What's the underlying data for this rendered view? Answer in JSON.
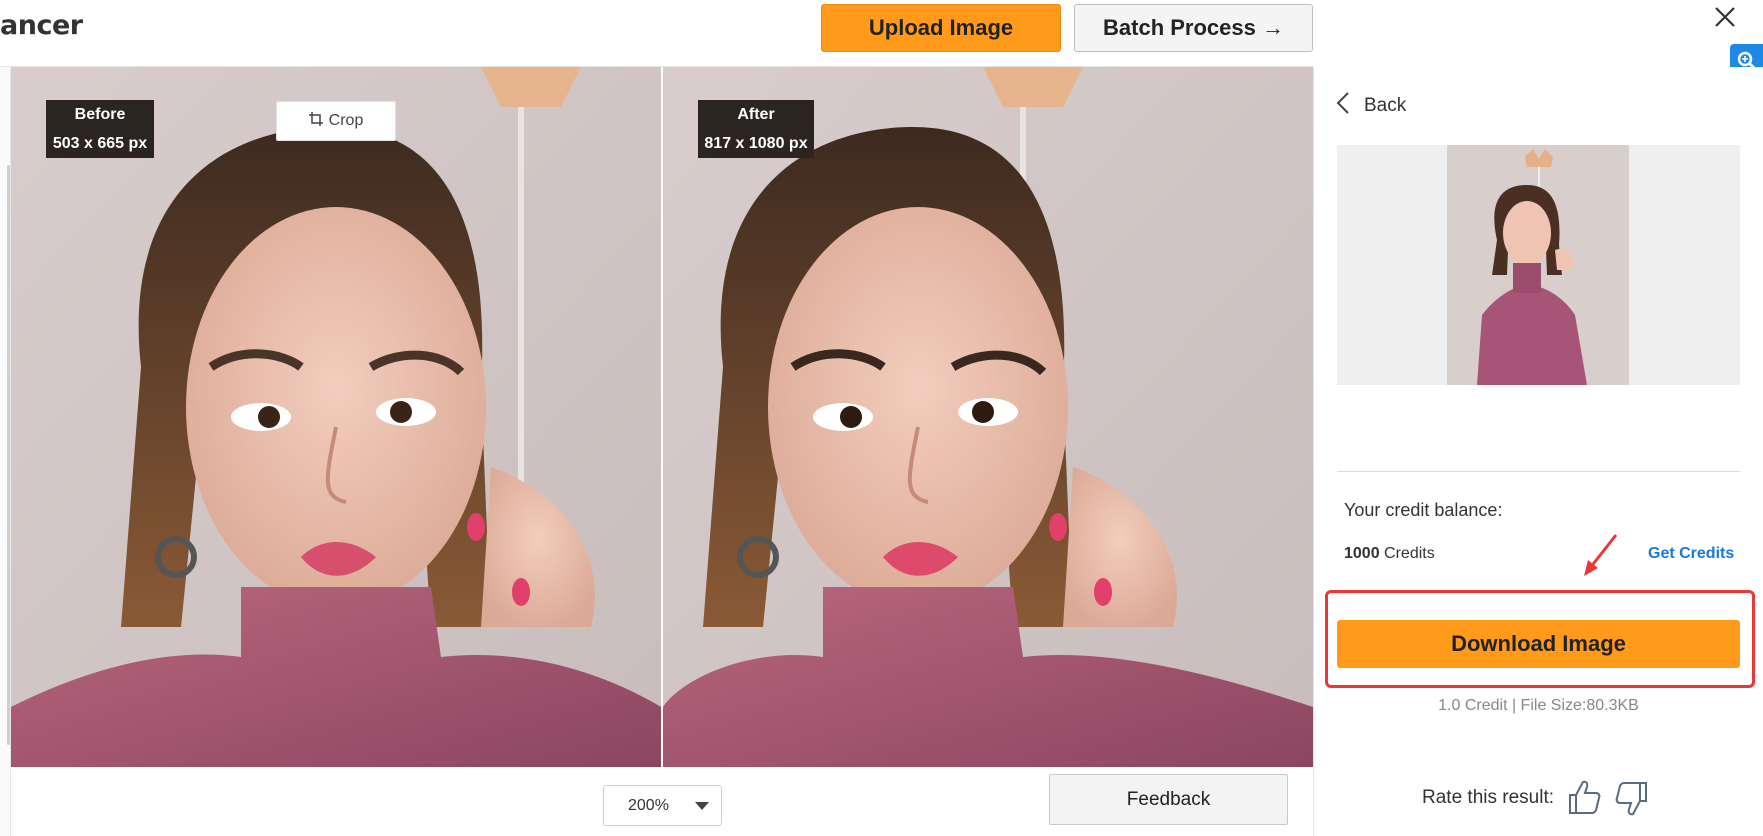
{
  "header": {
    "app_title": "ancer",
    "upload_label": "Upload Image",
    "batch_label": "Batch Process →",
    "close_icon": "close-icon",
    "zoom_icon": "magnifier-icon"
  },
  "viewer": {
    "before": {
      "title": "Before",
      "size": "503 x 665 px"
    },
    "after": {
      "title": "After",
      "size": "817 x 1080 px"
    },
    "crop_label": "Crop",
    "zoom_value": "200%",
    "feedback_label": "Feedback"
  },
  "sidebar": {
    "back_label": "Back",
    "credit_balance_label": "Your credit balance:",
    "credit_count": "1000",
    "credit_unit": "Credits",
    "get_credits_label": "Get Credits",
    "download_label": "Download Image",
    "download_info": "1.0 Credit | File Size:80.3KB",
    "rate_label": "Rate this result:"
  },
  "colors": {
    "accent_orange": "#ff9a1a",
    "link_blue": "#1b78e0",
    "highlight_red": "#e8383a"
  }
}
